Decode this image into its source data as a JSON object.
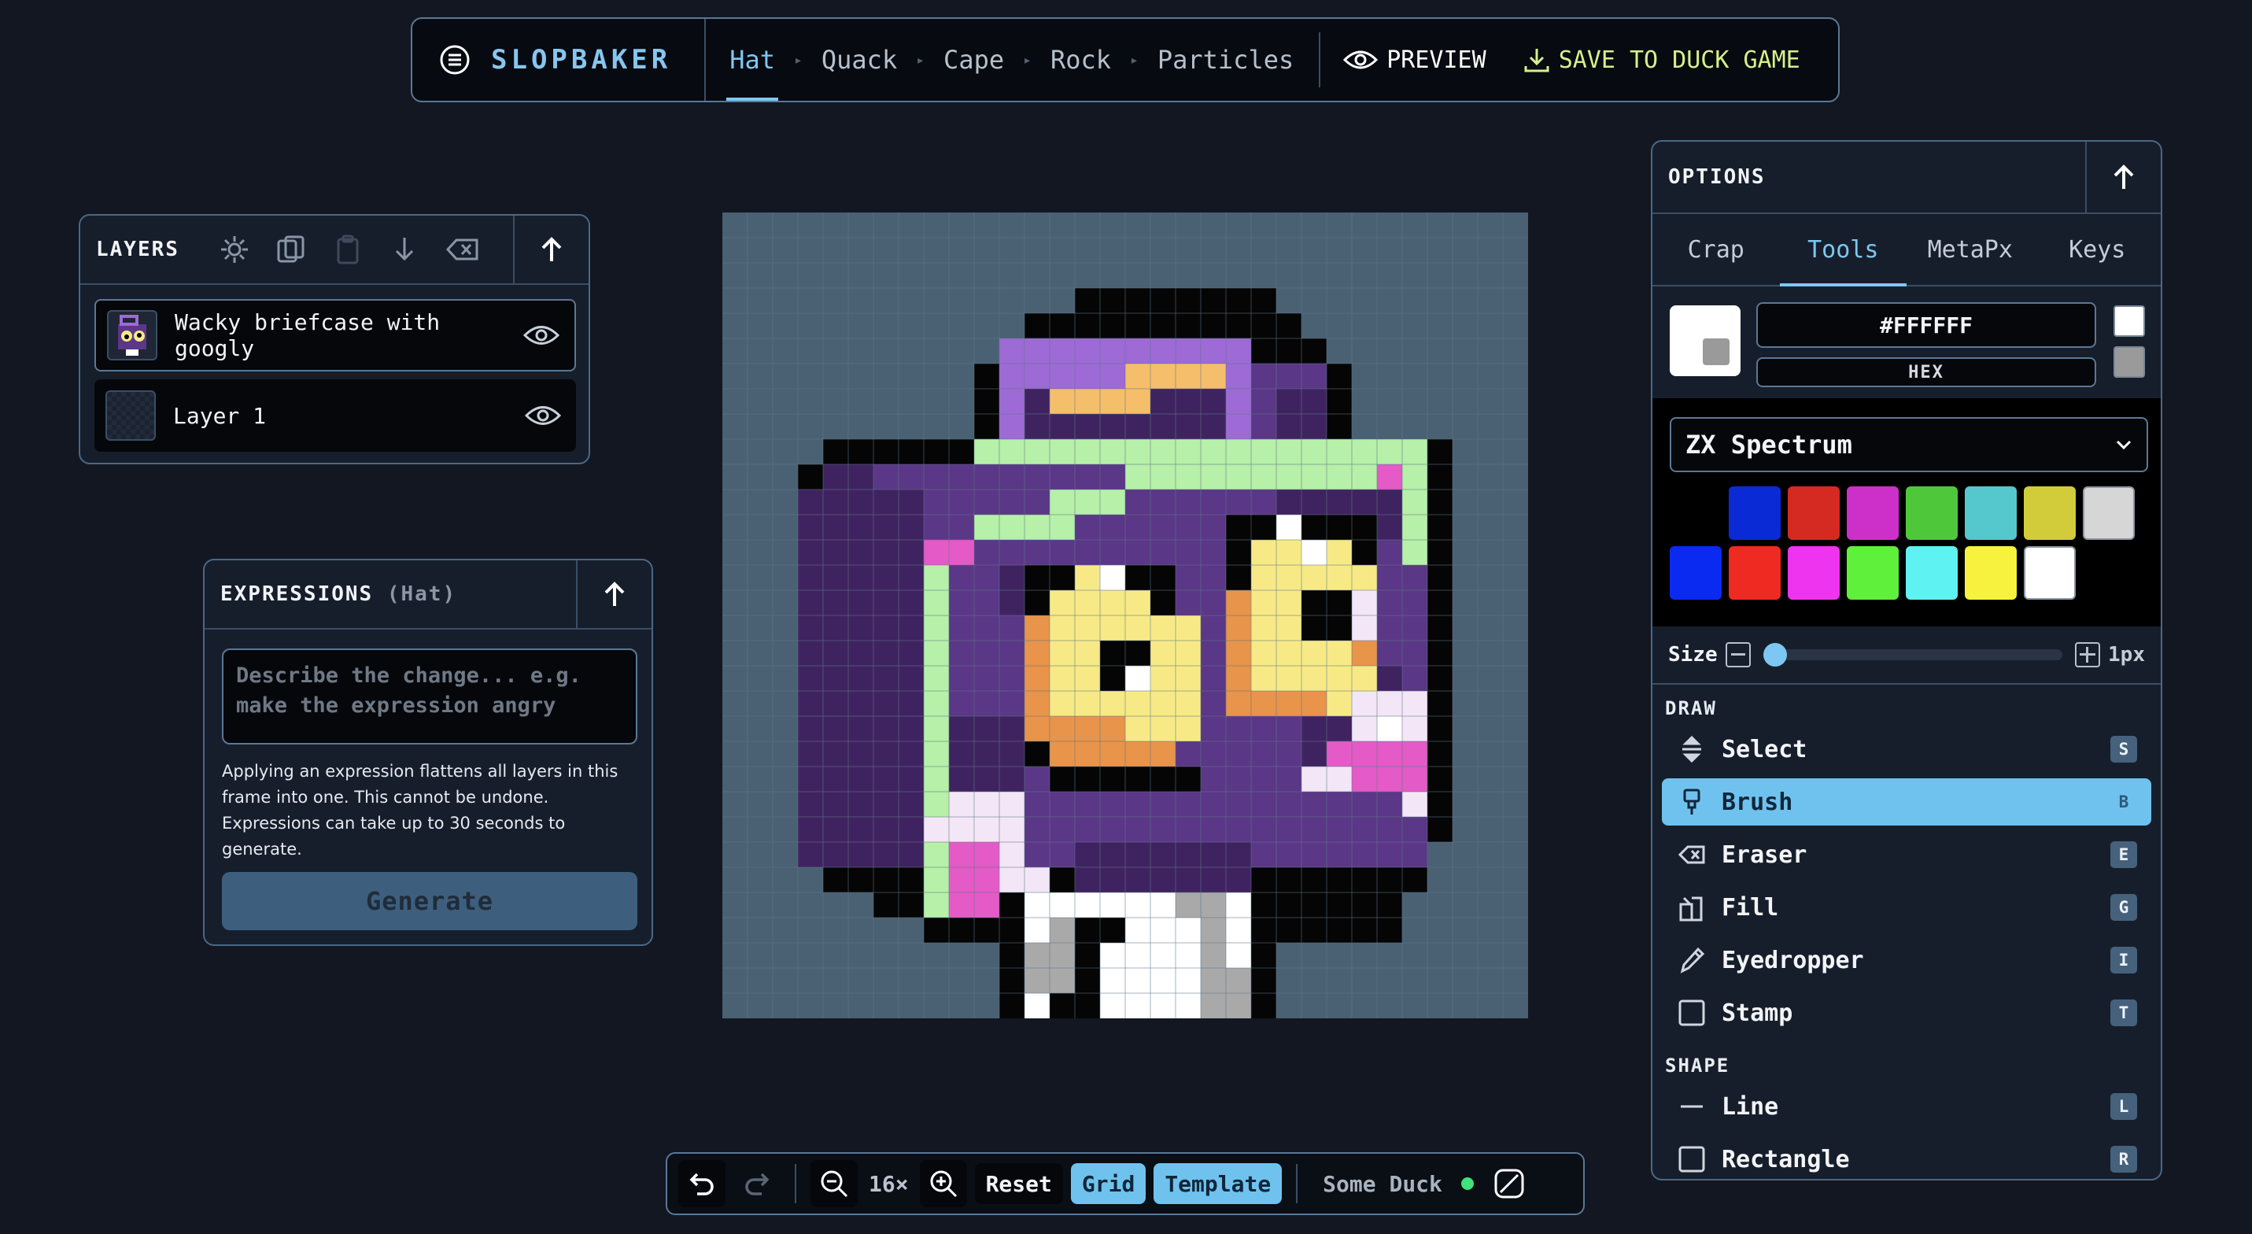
{
  "app": {
    "name": "SLOPBAKER"
  },
  "nav": {
    "crumbs": [
      "Hat",
      "Quack",
      "Cape",
      "Rock",
      "Particles"
    ],
    "active_crumb": "Hat",
    "preview_label": "PREVIEW",
    "save_label": "SAVE TO DUCK GAME"
  },
  "layers": {
    "title": "LAYERS",
    "items": [
      {
        "name": "Wacky briefcase with googly",
        "selected": true
      },
      {
        "name": "Layer 1",
        "selected": false
      }
    ]
  },
  "expressions": {
    "title": "EXPRESSIONS",
    "subtitle": "(Hat)",
    "placeholder": "Describe the change... e.g. make the expression angry",
    "note": "Applying an expression flattens all layers in this frame into one. This cannot be undone. Expressions can take up to 30 seconds to generate.",
    "generate_label": "Generate"
  },
  "toolbar": {
    "zoom": "16×",
    "reset_label": "Reset",
    "grid_label": "Grid",
    "template_label": "Template",
    "duck_name": "Some Duck"
  },
  "options": {
    "title": "OPTIONS",
    "tabs": [
      "Crap",
      "Tools",
      "MetaPx",
      "Keys"
    ],
    "active_tab": "Tools",
    "hex_value": "#FFFFFF",
    "hex_mode": "HEX",
    "palette_name": "ZX Spectrum",
    "palette_colors": [
      "#000000",
      "#0a2ad6",
      "#d42a22",
      "#cc30c8",
      "#4ec83a",
      "#54c8cc",
      "#d2cc3a",
      "#d6d6d6",
      "#0a2af2",
      "#ee2a22",
      "#ee34ee",
      "#5ef03a",
      "#5ef2f2",
      "#f6f23e",
      "#ffffff"
    ],
    "size_label": "Size",
    "size_value": "1px",
    "draw_section": "DRAW",
    "shape_section": "SHAPE",
    "draw_tools": [
      {
        "name": "Select",
        "key": "S",
        "icon": "select-icon"
      },
      {
        "name": "Brush",
        "key": "B",
        "icon": "brush-icon",
        "active": true
      },
      {
        "name": "Eraser",
        "key": "E",
        "icon": "eraser-icon"
      },
      {
        "name": "Fill",
        "key": "G",
        "icon": "fill-icon"
      },
      {
        "name": "Eyedropper",
        "key": "I",
        "icon": "eyedropper-icon"
      },
      {
        "name": "Stamp",
        "key": "T",
        "icon": "stamp-icon"
      }
    ],
    "shape_tools": [
      {
        "name": "Line",
        "key": "L",
        "icon": "line-icon"
      },
      {
        "name": "Rectangle",
        "key": "R",
        "icon": "rectangle-icon"
      }
    ]
  },
  "canvas": {
    "grid_size": 32,
    "colors": {
      "bg": "#4a6073",
      "grid": "#5f7689",
      "outline": "#050505",
      "purple_dark": "#3f2360",
      "purple": "#5b3787",
      "lavender": "#9d6ad6",
      "mint": "#b7f0a8",
      "yellow": "#f7ea86",
      "orange": "#e8944a",
      "pink": "#e45ac7",
      "white": "#ffffff",
      "light_pink": "#f3e6f6",
      "gray": "#a9a9a9",
      "peach": "#f5be6a"
    }
  }
}
